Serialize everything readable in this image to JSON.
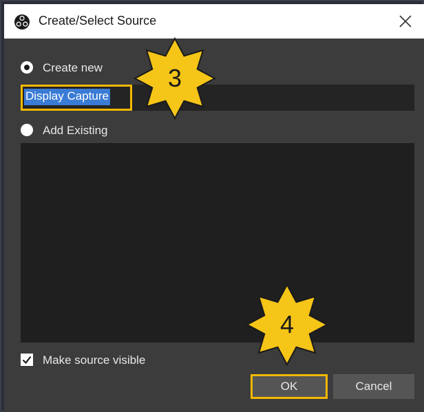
{
  "window": {
    "title": "Create/Select Source"
  },
  "icons": {
    "app": "obs-logo-icon",
    "close": "close-icon",
    "checkbox": "checkmark-icon"
  },
  "options": {
    "create_new_label": "Create new",
    "create_new_checked": true,
    "add_existing_label": "Add Existing",
    "add_existing_checked": false
  },
  "name_field": {
    "value": "Display Capture",
    "text_selected": true
  },
  "existing_sources": [],
  "visibility": {
    "label": "Make source visible",
    "checked": true
  },
  "buttons": {
    "ok_label": "OK",
    "cancel_label": "Cancel"
  },
  "annotations": {
    "step_a": "3",
    "step_b": "4"
  },
  "colors": {
    "highlight": "#f5b800",
    "selection": "#3a7bd5",
    "dialog_bg": "#3c3c3c"
  }
}
